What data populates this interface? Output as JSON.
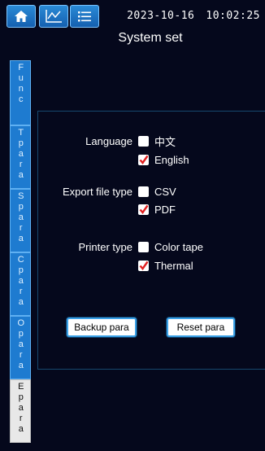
{
  "header": {
    "date": "2023-10-16",
    "time": "10:02:25",
    "title": "System set"
  },
  "icons": {
    "home": "home-icon",
    "trend": "trend-chart-icon",
    "list": "list-icon",
    "check": "checkmark-icon"
  },
  "colors": {
    "background": "#05081c",
    "tab_blue": "#1e7bd0",
    "tab_active": "#e8e8e8",
    "check_red": "#e02020",
    "button_border": "#3aa0e6"
  },
  "sidebar": {
    "tabs": [
      {
        "label": "Func",
        "active": false
      },
      {
        "label": "Tpara",
        "active": false
      },
      {
        "label": "Spara",
        "active": false
      },
      {
        "label": "Cpara",
        "active": false
      },
      {
        "label": "Opara",
        "active": false
      },
      {
        "label": "Epara",
        "active": true
      }
    ]
  },
  "settings": {
    "language": {
      "label": "Language",
      "options": [
        {
          "label": "中文",
          "checked": false
        },
        {
          "label": "English",
          "checked": true
        }
      ]
    },
    "export": {
      "label": "Export file type",
      "options": [
        {
          "label": "CSV",
          "checked": false
        },
        {
          "label": "PDF",
          "checked": true
        }
      ]
    },
    "printer": {
      "label": "Printer type",
      "options": [
        {
          "label": "Color tape",
          "checked": false
        },
        {
          "label": "Thermal",
          "checked": true
        }
      ]
    }
  },
  "actions": {
    "backup": "Backup para",
    "reset": "Reset para"
  }
}
